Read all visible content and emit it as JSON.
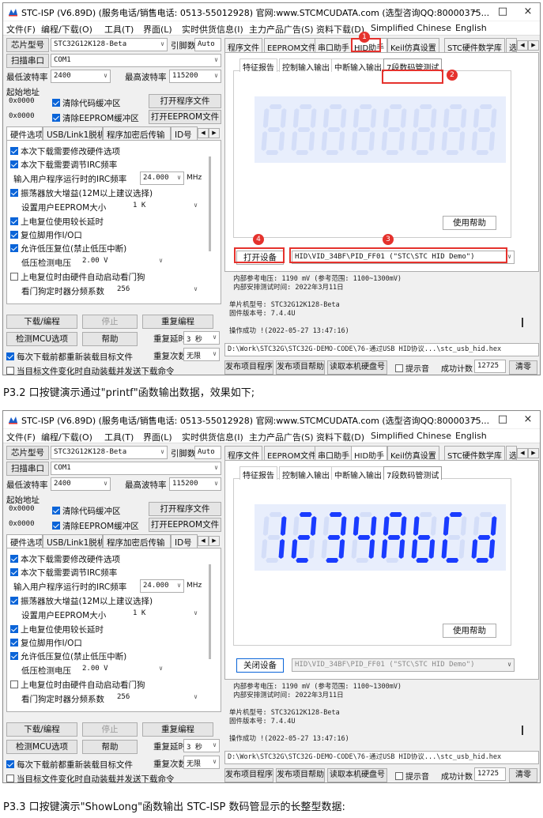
{
  "win1": {
    "title": "STC-ISP (V6.89D) (服务电话/销售电话: 0513-55012928) 官网:www.STCMCUDATA.com  (选型咨询QQ:80000375...",
    "ctl_min": "–",
    "ctl_max": "□",
    "ctl_close": "×",
    "menu": [
      "文件(F)",
      "编程/下载(O)",
      "工具(T)",
      "界面(L)",
      "实时供货信息(I)",
      "主力产品广告(S)",
      "资料下载(D)",
      "Simplified Chinese",
      "English"
    ],
    "left": {
      "chip_label": "芯片型号",
      "chip_value": "STC32G12K128-Beta",
      "pins_label": "引脚数",
      "pins_value": "Auto",
      "scan_btn": "扫描串口",
      "port_value": "COM1",
      "min_baud_label": "最低波特率",
      "min_baud_value": "2400",
      "max_baud_label": "最高波特率",
      "max_baud_value": "115200",
      "start_addr_label": "起始地址",
      "addr1": "0x0000",
      "clear_code": "清除代码缓冲区",
      "open_prog": "打开程序文件",
      "addr2": "0x0000",
      "clear_eep": "清除EEPROM缓冲区",
      "open_eep": "打开EEPROM文件",
      "tabs": [
        "硬件选项",
        "USB/Link1脱机",
        "程序加密后传输",
        "ID号"
      ],
      "opt_modify": "本次下载需要修改硬件选项",
      "opt_irc": "本次下载需要调节IRC频率",
      "irc_label": "输入用户程序运行时的IRC频率",
      "irc_value": "24.000",
      "irc_unit": "MHz",
      "opt_amp": "振荡器放大增益(12M以上建议选择)",
      "eeprom_label": "设置用户EEPROM大小",
      "eeprom_value": "1   K",
      "opt_longdelay": "上电复位使用较长延时",
      "opt_resetpin": "复位脚用作I/O口",
      "opt_lowvolt": "允许低压复位(禁止低压中断)",
      "lowvolt_label": "低压检测电压",
      "lowvolt_value": "2.00 V",
      "opt_wdt": "上电复位时由硬件自动启动看门狗",
      "wdt_label": "看门狗定时器分频系数",
      "wdt_value": "256",
      "download_btn": "下载/编程",
      "stop_btn": "停止",
      "reprog_btn": "重复编程",
      "detect_btn": "检测MCU选项",
      "help_btn": "帮助",
      "repeat_delay_label": "重复延时",
      "repeat_delay_value": "3 秒",
      "reload_label": "每次下载前都重新装载目标文件",
      "repeat_count_label": "重复次数",
      "repeat_count_value": "无限",
      "auto_label": "当目标文件变化时自动装载并发送下载命令"
    },
    "right": {
      "tabs": [
        "程序文件",
        "EEPROM文件",
        "串口助手",
        "HID助手",
        "Keil仿真设置",
        "STC硬件数学库",
        "选"
      ],
      "subtabs": [
        "特征报告",
        "控制输入输出",
        "中断输入输出",
        "7段数码管测试"
      ],
      "help_btn": "使用帮助",
      "open_dev": "打开设备",
      "device_value": "HID\\VID_34BF\\PID_FF01 (\"STC\\STC HID Demo\")",
      "info": " 内部参考电压: 1190 mV (参考范围: 1100~1300mV)\n 内部安排测试时间: 2022年3月11日\n\n单片机型号: STC32G12K128-Beta\n固件版本号: 7.4.4U\n\n操作成功 !(2022-05-27 13:47:16)",
      "path": "D:\\Work\\STC32G\\STC32G-DEMO-CODE\\76-通过USB HID协议...\\stc_usb_hid.hex",
      "pub_prog": "发布项目程序",
      "pub_help": "发布项目帮助",
      "read_disk": "读取本机硬盘号",
      "beep_label": "提示音",
      "count_label": "成功计数",
      "count_value": "12725",
      "clear_btn": "清零"
    },
    "badges": [
      "1",
      "2",
      "3",
      "4"
    ]
  },
  "caption1": "P3.2 口按键演示通过\"printf\"函数输出数据，效果如下;",
  "win2": {
    "title": "STC-ISP (V6.89D) (服务电话/销售电话: 0513-55012928) 官网:www.STCMCUDATA.com  (选型咨询QQ:80000375...",
    "ctl_min": "–",
    "ctl_max": "□",
    "ctl_close": "×",
    "menu": [
      "文件(F)",
      "编程/下载(O)",
      "工具(T)",
      "界面(L)",
      "实时供货信息(I)",
      "主力产品广告(S)",
      "资料下载(D)",
      "Simplified Chinese",
      "English"
    ],
    "right": {
      "close_dev": "关闭设备",
      "display_text": "1234AbCd"
    }
  },
  "caption2": "P3.3 口按键演示\"ShowLong\"函数输出 STC-ISP 数码管显示的长整型数据:",
  "colors": {
    "accent": "#0a64d8",
    "mark": "#e5322d",
    "segment_on": "#1a3cff",
    "segment_off": "#d4def8"
  }
}
